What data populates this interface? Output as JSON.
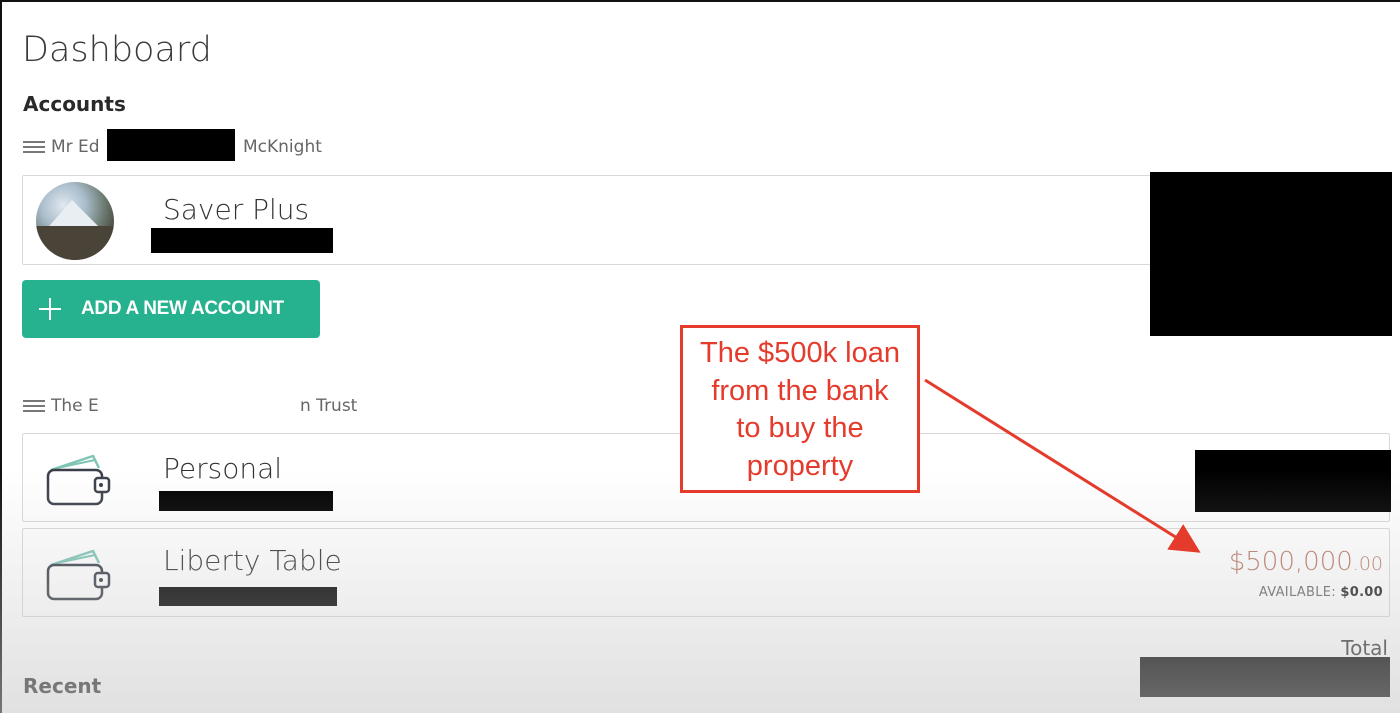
{
  "page": {
    "title": "Dashboard"
  },
  "accounts_section": {
    "heading": "Accounts"
  },
  "groups": [
    {
      "prefix": "Mr Ed",
      "suffix": "McKnight",
      "accounts": [
        {
          "name": "Saver Plus",
          "icon": "landscape-avatar"
        }
      ]
    },
    {
      "prefix": "The E",
      "suffix": "n Trust",
      "accounts": [
        {
          "name": "Personal",
          "icon": "wallet-icon"
        },
        {
          "name": "Liberty Table",
          "icon": "wallet-icon",
          "balance": "$500,000",
          "balance_cents": ".00",
          "available_label": "AVAILABLE:",
          "available_value": "$0.00"
        }
      ]
    }
  ],
  "add_account_button": {
    "label": "ADD A NEW ACCOUNT",
    "icon": "plus-icon"
  },
  "total": {
    "label": "Total"
  },
  "recent_section": {
    "heading": "Recent"
  },
  "annotation": {
    "lines": [
      "The $500k loan",
      "from the bank",
      "to buy the",
      "property"
    ],
    "color": "#e53b2c"
  },
  "colors": {
    "accent": "#26b28e",
    "balance": "#b97a68",
    "wallet_accent": "#7fc4b5"
  }
}
